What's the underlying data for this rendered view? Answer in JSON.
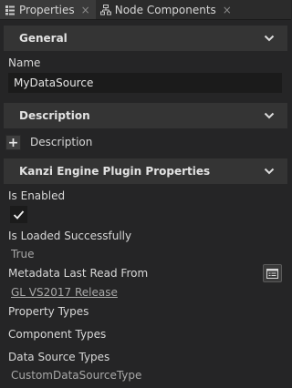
{
  "tabs": [
    {
      "label": "Properties",
      "close": "×",
      "icon": "properties-icon"
    },
    {
      "label": "Node Components",
      "close": "×",
      "icon": "node-components-icon"
    }
  ],
  "sections": {
    "general": {
      "title": "General",
      "icon": "chevron-down-icon"
    },
    "description": {
      "title": "Description",
      "icon": "chevron-down-icon"
    },
    "kanzi": {
      "title": "Kanzi Engine Plugin Properties",
      "icon": "chevron-down-icon"
    }
  },
  "general": {
    "name_label": "Name",
    "name_value": "MyDataSource"
  },
  "description": {
    "add_label": "+",
    "label": "Description"
  },
  "kanzi": {
    "is_enabled_label": "Is Enabled",
    "is_enabled_checked": true,
    "is_loaded_label": "Is Loaded Successfully",
    "is_loaded_value": "True",
    "metadata_label": "Metadata Last Read From",
    "metadata_value": "GL VS2017 Release",
    "property_types_label": "Property Types",
    "component_types_label": "Component Types",
    "data_source_types_label": "Data Source Types",
    "data_source_types_value": "CustomDataSourceType"
  },
  "colors": {
    "background": "#252526",
    "header": "#343434",
    "input": "#1b1b1b",
    "text": "#d6d6d6",
    "muted": "#a8a8a8"
  }
}
